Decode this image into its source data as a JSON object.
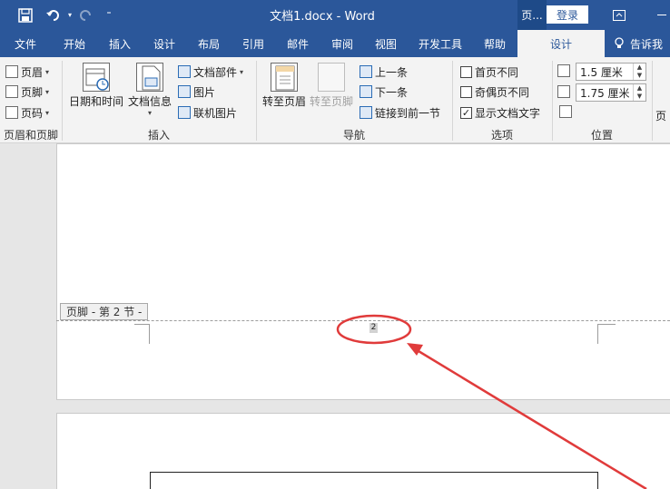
{
  "titlebar": {
    "title": "文档1.docx  -  Word",
    "context_tab": "页...",
    "login": "登录"
  },
  "tabs": [
    {
      "label": "文件"
    },
    {
      "label": "开始"
    },
    {
      "label": "插入"
    },
    {
      "label": "设计"
    },
    {
      "label": "布局"
    },
    {
      "label": "引用"
    },
    {
      "label": "邮件"
    },
    {
      "label": "审阅"
    },
    {
      "label": "视图"
    },
    {
      "label": "开发工具"
    },
    {
      "label": "帮助"
    },
    {
      "label": "设计"
    }
  ],
  "tellme": "告诉我",
  "ribbon": {
    "hf_group": {
      "header": "页眉",
      "footer": "页脚",
      "page_number": "页码",
      "label": "页眉和页脚"
    },
    "insert_group": {
      "datetime": "日期和时间",
      "docinfo": "文档信息",
      "quickparts": "文档部件",
      "pictures": "图片",
      "online_pictures": "联机图片",
      "label": "插入"
    },
    "nav_group": {
      "goto_header": "转至页眉",
      "goto_footer": "转至页脚",
      "previous": "上一条",
      "next": "下一条",
      "link_previous": "链接到前一节",
      "label": "导航"
    },
    "options_group": {
      "first_page": "首页不同",
      "odd_even": "奇偶页不同",
      "show_text": "显示文档文字",
      "label": "选项"
    },
    "position_group": {
      "header_top": "1.5 厘米",
      "footer_bottom": "1.75 厘米",
      "label": "位置"
    },
    "close_group": {
      "label": "页"
    }
  },
  "document": {
    "footer_tag": "页脚 - 第 2 节 -",
    "page_number": "2"
  },
  "colors": {
    "accent": "#2b579a",
    "annotation": "#e03b3b"
  }
}
